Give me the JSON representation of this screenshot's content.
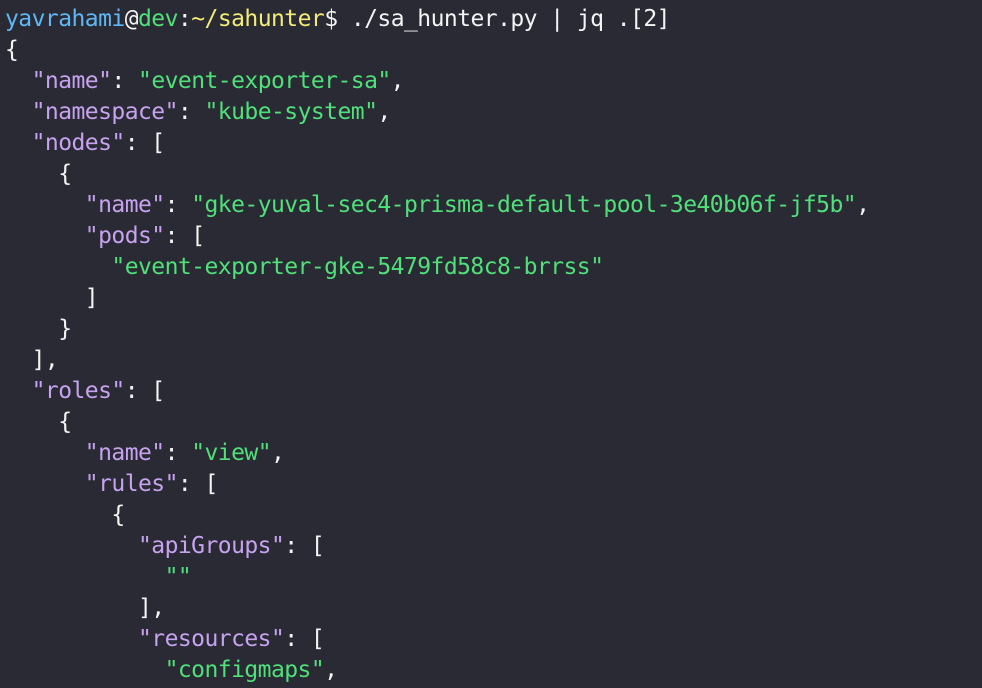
{
  "prompt": {
    "user": "yavrahami",
    "at": "@",
    "host": "dev",
    "sep": ":",
    "path": "~/sahunter",
    "dollar": "$",
    "command": " ./sa_hunter.py | jq .[2]"
  },
  "colors": {
    "background": "#292a33",
    "key": "#c6a2ef",
    "string": "#4fe07a",
    "punctuation": "#f4f4f4",
    "user": "#5fb8f5",
    "host": "#4fe07a",
    "path": "#f2ec78"
  },
  "json_output": {
    "open_brace": "{",
    "name_key": "\"name\"",
    "name_value": "\"event-exporter-sa\"",
    "namespace_key": "\"namespace\"",
    "namespace_value": "\"kube-system\"",
    "nodes_key": "\"nodes\"",
    "node_name_key": "\"name\"",
    "node_name_value": "\"gke-yuval-sec4-prisma-default-pool-3e40b06f-jf5b\"",
    "pods_key": "\"pods\"",
    "pod_value": "\"event-exporter-gke-5479fd58c8-brrss\"",
    "roles_key": "\"roles\"",
    "role_name_key": "\"name\"",
    "role_name_value": "\"view\"",
    "rules_key": "\"rules\"",
    "apigroups_key": "\"apiGroups\"",
    "apigroups_value": "\"\"",
    "resources_key": "\"resources\"",
    "resource_value": "\"configmaps\""
  }
}
